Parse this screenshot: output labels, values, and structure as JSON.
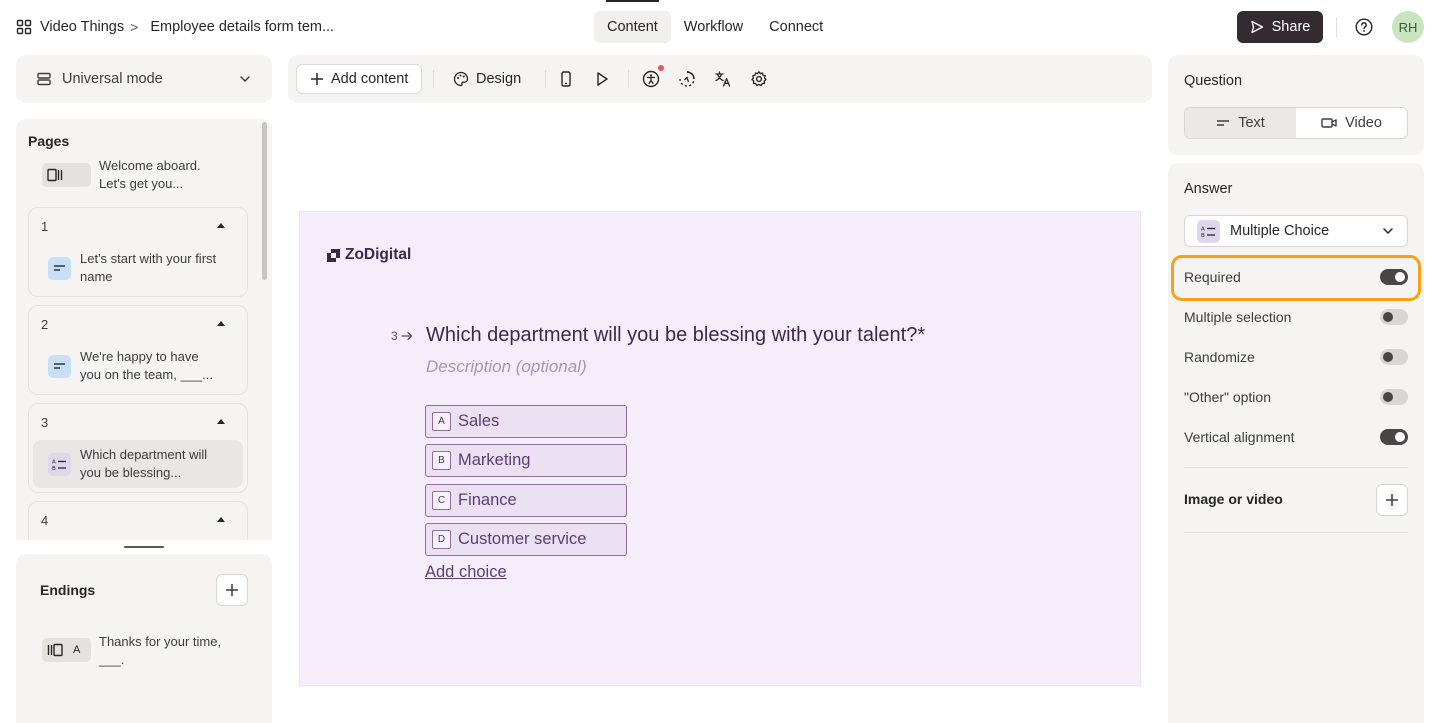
{
  "header": {
    "workspace": "Video Things",
    "separator": ">",
    "form_name": "Employee details form tem...",
    "tabs": [
      {
        "label": "Content",
        "active": true
      },
      {
        "label": "Workflow",
        "active": false
      },
      {
        "label": "Connect",
        "active": false
      }
    ],
    "share_label": "Share",
    "avatar_initials": "RH"
  },
  "left": {
    "mode_label": "Universal mode",
    "pages_title": "Pages",
    "welcome_text": "Welcome aboard. Let's get you...",
    "pages": [
      {
        "number": "1",
        "text": "Let's start with your first name",
        "type": "text"
      },
      {
        "number": "2",
        "text": "We're happy to have you on the team, ___...",
        "type": "text"
      },
      {
        "number": "3",
        "text": "Which department will you be blessing...",
        "type": "multiple-choice"
      },
      {
        "number": "4"
      }
    ],
    "endings_title": "Endings",
    "ending_letter": "A",
    "ending_text": "Thanks for your time, ___."
  },
  "toolbar": {
    "add_content_label": "Add content",
    "design_label": "Design"
  },
  "canvas": {
    "brand_name": "ZoDigital",
    "question_number": "3",
    "question_title": "Which department will you be blessing with your talent?*",
    "description_placeholder": "Description (optional)",
    "choices": [
      {
        "key": "A",
        "label": "Sales"
      },
      {
        "key": "B",
        "label": "Marketing"
      },
      {
        "key": "C",
        "label": "Finance"
      },
      {
        "key": "D",
        "label": "Customer service"
      }
    ],
    "add_choice_label": "Add choice"
  },
  "right": {
    "question_title": "Question",
    "question_types": [
      {
        "label": "Text",
        "active": true
      },
      {
        "label": "Video",
        "active": false
      }
    ],
    "answer_title": "Answer",
    "answer_type": "Multiple Choice",
    "settings": [
      {
        "label": "Required",
        "on": true
      },
      {
        "label": "Multiple selection",
        "on": false
      },
      {
        "label": "Randomize",
        "on": false
      },
      {
        "label": "\"Other\" option",
        "on": false
      },
      {
        "label": "Vertical alignment",
        "on": true
      }
    ],
    "media_title": "Image or video"
  },
  "colors": {
    "canvas_bg": "#f5eefa",
    "accent": "#5b3e73",
    "highlight": "#f5a21a",
    "share_bg": "#332b2f"
  }
}
